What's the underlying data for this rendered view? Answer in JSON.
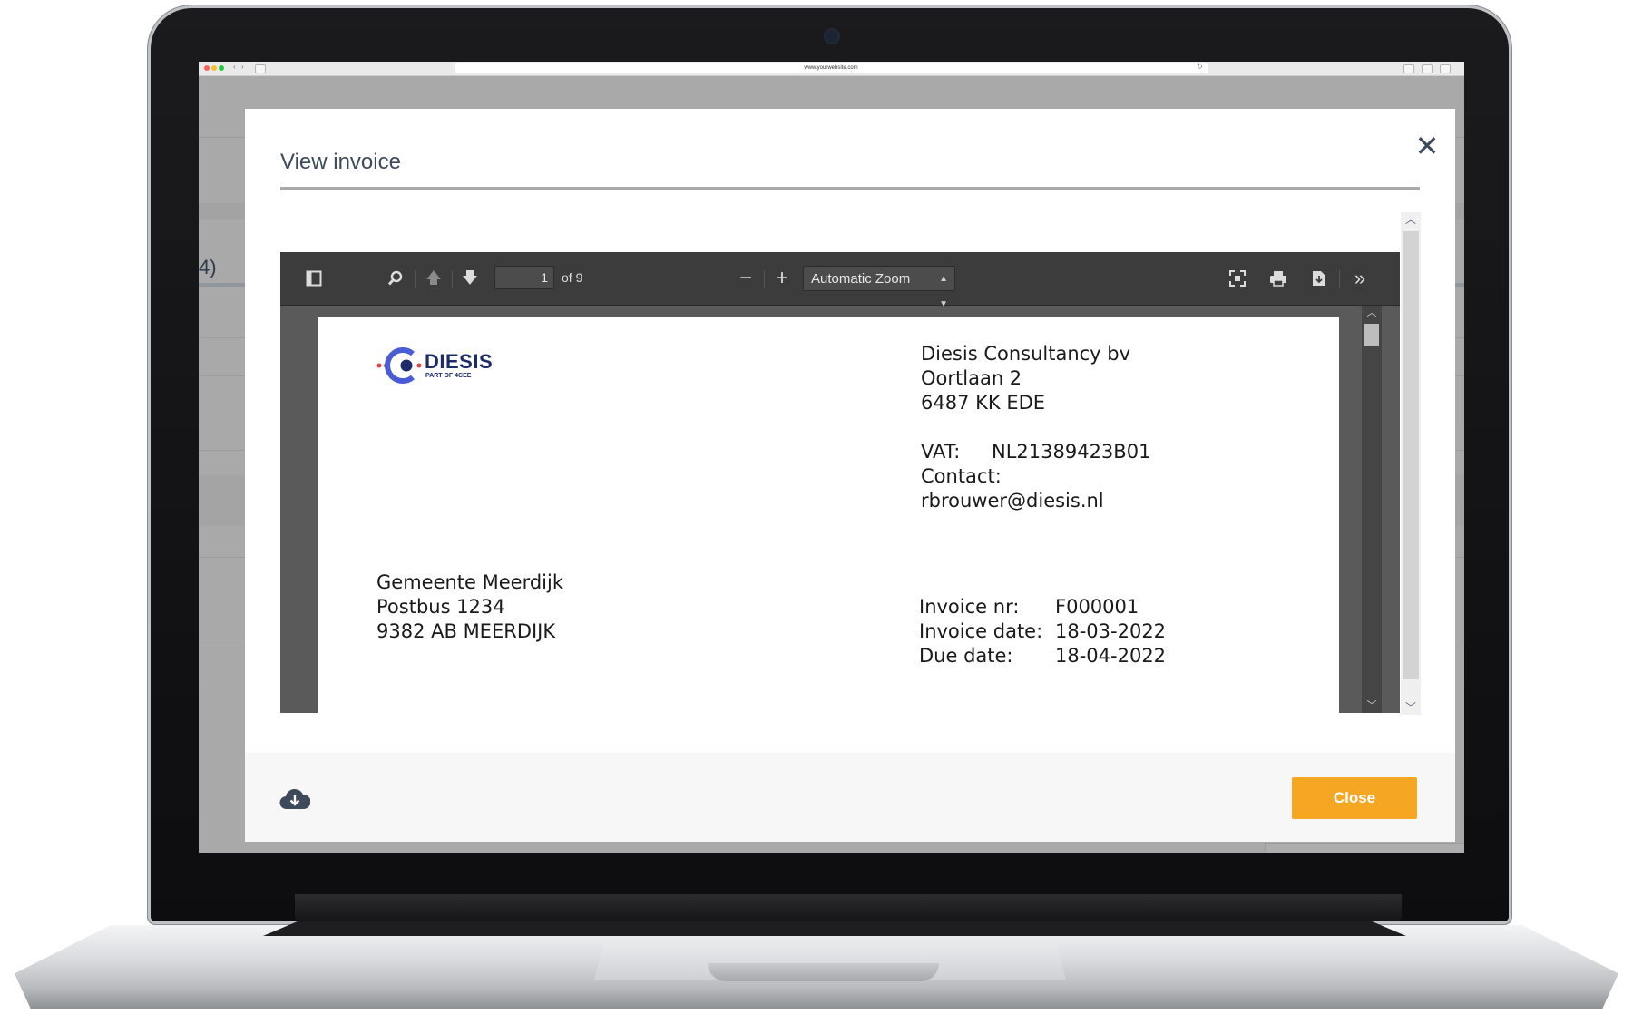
{
  "browser": {
    "url": "www.yourwebsite.com"
  },
  "background_app": {
    "partial_heading": "4)"
  },
  "modal": {
    "title": "View invoice",
    "close_icon": "close-x-icon",
    "footer": {
      "download_icon": "cloud-download-icon",
      "close_label": "Close"
    }
  },
  "pdf_viewer": {
    "toolbar": {
      "current_page": "1",
      "page_count_label": "of 9",
      "zoom_label": "Automatic Zoom"
    },
    "invoice": {
      "logo_text": "DIESIS",
      "logo_subtext": "PART OF 4CEE",
      "sender": {
        "name": "Diesis Consultancy bv",
        "street": "Oortlaan 2",
        "city": "6487 KK EDE",
        "vat_label": "VAT:",
        "vat_value": "NL21389423B01",
        "contact_label": "Contact:",
        "contact_email": "rbrouwer@diesis.nl"
      },
      "recipient": {
        "name": "Gemeente Meerdijk",
        "street": "Postbus 1234",
        "city": "9382 AB MEERDIJK"
      },
      "details": {
        "invoice_nr_label": "Invoice nr:",
        "invoice_nr_value": "F000001",
        "invoice_date_label": "Invoice date:",
        "invoice_date_value": "18-03-2022",
        "due_date_label": "Due date:",
        "due_date_value": "18-04-2022"
      }
    }
  },
  "colors": {
    "accent_button": "#f5a623",
    "title_text": "#3d4a5c",
    "logo_navy": "#1d2b6b",
    "logo_red": "#e0463c"
  }
}
